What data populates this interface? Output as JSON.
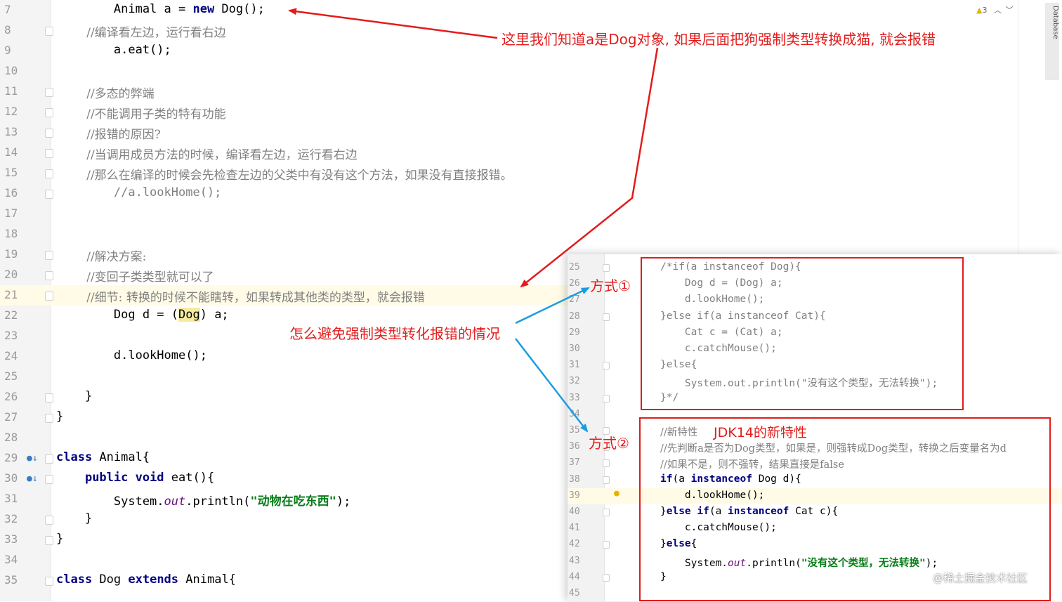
{
  "editor": {
    "lines": [
      {
        "num": "7",
        "code": [
          {
            "t": "        Animal a = "
          },
          {
            "t": "new",
            "c": "kw"
          },
          {
            "t": " Dog();"
          }
        ]
      },
      {
        "num": "8",
        "code": [
          {
            "t": "        //编译看左边，运行看右边",
            "c": "cm"
          }
        ]
      },
      {
        "num": "9",
        "code": [
          {
            "t": "        a.eat();"
          }
        ]
      },
      {
        "num": "10",
        "code": []
      },
      {
        "num": "11",
        "code": [
          {
            "t": "        //多态的弊端",
            "c": "cm"
          }
        ]
      },
      {
        "num": "12",
        "code": [
          {
            "t": "        //不能调用子类的特有功能",
            "c": "cm"
          }
        ]
      },
      {
        "num": "13",
        "code": [
          {
            "t": "        //报错的原因?",
            "c": "cm"
          }
        ]
      },
      {
        "num": "14",
        "code": [
          {
            "t": "        //当调用成员方法的时候，编译看左边，运行看右边",
            "c": "cm"
          }
        ]
      },
      {
        "num": "15",
        "code": [
          {
            "t": "        //那么在编译的时候会先检查左边的父类中有没有这个方法，如果没有直接报错。",
            "c": "cm"
          }
        ]
      },
      {
        "num": "16",
        "code": [
          {
            "t": "        //a.lookHome();",
            "c": "cmm"
          }
        ]
      },
      {
        "num": "17",
        "code": []
      },
      {
        "num": "18",
        "code": []
      },
      {
        "num": "19",
        "code": [
          {
            "t": "        //解决方案:",
            "c": "cm"
          }
        ]
      },
      {
        "num": "20",
        "code": [
          {
            "t": "        //变回子类类型就可以了",
            "c": "cm"
          }
        ]
      },
      {
        "num": "21",
        "code": [
          {
            "t": "        //细节: 转换的时候不能瞎转，如果转成其他类的类型，就会报错",
            "c": "cm"
          }
        ],
        "current": true
      },
      {
        "num": "22",
        "code": [
          {
            "t": "        Dog d = ("
          },
          {
            "t": "Dog",
            "c": "hl"
          },
          {
            "t": ") a;"
          }
        ]
      },
      {
        "num": "23",
        "code": []
      },
      {
        "num": "24",
        "code": [
          {
            "t": "        d.lookHome();"
          }
        ]
      },
      {
        "num": "25",
        "code": []
      },
      {
        "num": "26",
        "code": [
          {
            "t": "    }"
          }
        ]
      },
      {
        "num": "27",
        "code": [
          {
            "t": "}"
          }
        ]
      },
      {
        "num": "28",
        "code": []
      },
      {
        "num": "29",
        "code": [
          {
            "t": "class",
            "c": "kw"
          },
          {
            "t": " Animal{"
          }
        ],
        "gicon": true
      },
      {
        "num": "30",
        "code": [
          {
            "t": "    "
          },
          {
            "t": "public void",
            "c": "kw"
          },
          {
            "t": " eat(){"
          }
        ],
        "gicon": true
      },
      {
        "num": "31",
        "code": [
          {
            "t": "        System."
          },
          {
            "t": "out",
            "c": "it"
          },
          {
            "t": ".println("
          },
          {
            "t": "\"动物在吃东西\"",
            "c": "str"
          },
          {
            "t": ");"
          }
        ]
      },
      {
        "num": "32",
        "code": [
          {
            "t": "    }"
          }
        ]
      },
      {
        "num": "33",
        "code": [
          {
            "t": "}"
          }
        ]
      },
      {
        "num": "34",
        "code": []
      },
      {
        "num": "35",
        "code": [
          {
            "t": "class",
            "c": "kw"
          },
          {
            "t": " Dog "
          },
          {
            "t": "extends",
            "c": "kw"
          },
          {
            "t": " Animal{"
          }
        ]
      }
    ],
    "inspection_count": "3",
    "database_tab": "Database"
  },
  "inset": {
    "lines": [
      {
        "num": "25",
        "code": [
          {
            "t": "/*if(a instanceof Dog){",
            "c": "cmm"
          }
        ]
      },
      {
        "num": "26",
        "code": [
          {
            "t": "    Dog d = (Dog) a;",
            "c": "cmm"
          }
        ]
      },
      {
        "num": "27",
        "code": [
          {
            "t": "    d.lookHome();",
            "c": "cmm"
          }
        ]
      },
      {
        "num": "28",
        "code": [
          {
            "t": "}else if(a instanceof Cat){",
            "c": "cmm"
          }
        ]
      },
      {
        "num": "29",
        "code": [
          {
            "t": "    Cat c = (Cat) a;",
            "c": "cmm"
          }
        ]
      },
      {
        "num": "30",
        "code": [
          {
            "t": "    c.catchMouse();",
            "c": "cmm"
          }
        ]
      },
      {
        "num": "31",
        "code": [
          {
            "t": "}else{",
            "c": "cmm"
          }
        ]
      },
      {
        "num": "32",
        "code": [
          {
            "t": "    System.out.println(\"没有这个类型，无法转换\");",
            "c": "cmm"
          }
        ]
      },
      {
        "num": "33",
        "code": [
          {
            "t": "}*/",
            "c": "cmm"
          }
        ]
      },
      {
        "num": "34",
        "code": []
      },
      {
        "num": "35",
        "code": [
          {
            "t": "//新特性",
            "c": "cm"
          }
        ]
      },
      {
        "num": "36",
        "code": [
          {
            "t": "//先判断a是否为Dog类型，如果是，则强转成Dog类型，转换之后变量名为d",
            "c": "cm"
          }
        ]
      },
      {
        "num": "37",
        "code": [
          {
            "t": "//如果不是，则不强转，结果直接是false",
            "c": "cm"
          }
        ]
      },
      {
        "num": "38",
        "code": [
          {
            "t": "if",
            "c": "kw"
          },
          {
            "t": "(a "
          },
          {
            "t": "instanceof",
            "c": "kw"
          },
          {
            "t": " Dog d){"
          }
        ]
      },
      {
        "num": "39",
        "code": [
          {
            "t": "    d.lookHome();"
          }
        ],
        "current": true
      },
      {
        "num": "40",
        "code": [
          {
            "t": "}"
          },
          {
            "t": "else if",
            "c": "kw"
          },
          {
            "t": "(a "
          },
          {
            "t": "instanceof",
            "c": "kw"
          },
          {
            "t": " Cat c){"
          }
        ]
      },
      {
        "num": "41",
        "code": [
          {
            "t": "    c.catchMouse();"
          }
        ]
      },
      {
        "num": "42",
        "code": [
          {
            "t": "}"
          },
          {
            "t": "else",
            "c": "kw"
          },
          {
            "t": "{"
          }
        ]
      },
      {
        "num": "43",
        "code": [
          {
            "t": "    System."
          },
          {
            "t": "out",
            "c": "it"
          },
          {
            "t": ".println("
          },
          {
            "t": "\"没有这个类型，无法转换\"",
            "c": "str"
          },
          {
            "t": ");"
          }
        ]
      },
      {
        "num": "44",
        "code": [
          {
            "t": "}"
          }
        ]
      },
      {
        "num": "45",
        "code": []
      }
    ]
  },
  "annotations": {
    "top_note": "这里我们知道a是Dog对象, 如果后面把狗强制类型转换成猫, 就会报错",
    "middle_note": "怎么避免强制类型转化报错的情况",
    "method1": "方式①",
    "method2": "方式②",
    "jdk_note": "JDK14的新特性"
  },
  "watermark": "@稀土掘金技术社区",
  "colors": {
    "annotation_red": "#e31b1b",
    "arrow_blue": "#1a9de0"
  }
}
